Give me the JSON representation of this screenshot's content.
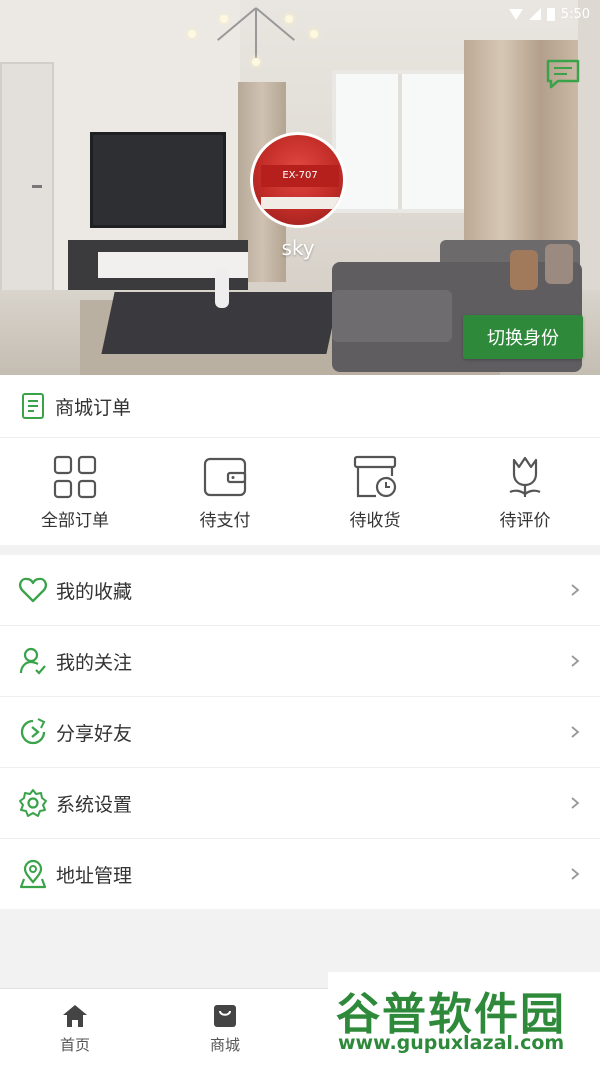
{
  "status_bar": {
    "time": "5:50"
  },
  "profile": {
    "username": "sky",
    "avatar_text": "EX-707",
    "switch_identity_label": "切换身份"
  },
  "orders": {
    "title": "商城订单",
    "tabs": [
      {
        "label": "全部订单",
        "icon": "grid-icon"
      },
      {
        "label": "待支付",
        "icon": "wallet-icon"
      },
      {
        "label": "待收货",
        "icon": "package-clock-icon"
      },
      {
        "label": "待评价",
        "icon": "tulip-icon"
      }
    ]
  },
  "menu": [
    {
      "label": "我的收藏",
      "icon": "heart-icon"
    },
    {
      "label": "我的关注",
      "icon": "user-follow-icon"
    },
    {
      "label": "分享好友",
      "icon": "share-icon"
    },
    {
      "label": "系统设置",
      "icon": "gear-icon"
    },
    {
      "label": "地址管理",
      "icon": "location-icon"
    }
  ],
  "tabbar": [
    {
      "label": "首页",
      "icon": "home-icon"
    },
    {
      "label": "商城",
      "icon": "shop-bag-icon"
    }
  ],
  "watermark": {
    "title": "谷普软件园",
    "url": "www.gupuxlazal.com"
  },
  "colors": {
    "accent": "#2e8a3a",
    "text": "#333333",
    "background": "#f2f2f2"
  }
}
